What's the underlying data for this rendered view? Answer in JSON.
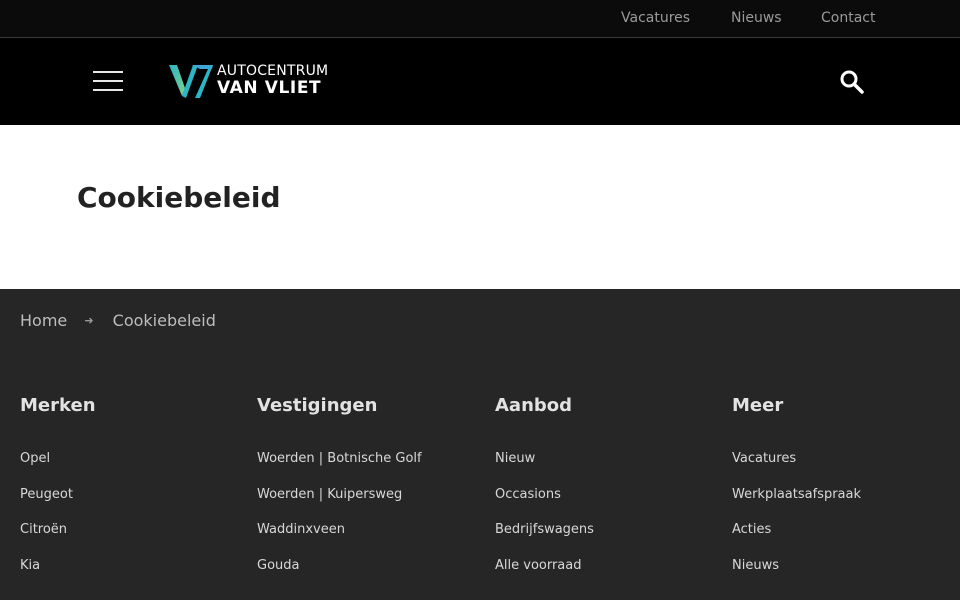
{
  "topnav": {
    "links": [
      "Vacatures",
      "Nieuws",
      "Contact"
    ]
  },
  "header": {
    "menu_icon": "hamburger-menu-icon",
    "logo": {
      "line1": "AUTOCENTRUM",
      "line2": "VAN VLIET"
    },
    "search_icon": "search-icon"
  },
  "page": {
    "title": "Cookiebeleid"
  },
  "breadcrumb": {
    "home": "Home",
    "separator_icon": "arrow-right-icon",
    "current": "Cookiebeleid"
  },
  "footer": {
    "columns": [
      {
        "title": "Merken",
        "items": [
          "Opel",
          "Peugeot",
          "Citroën",
          "Kia"
        ]
      },
      {
        "title": "Vestigingen",
        "items": [
          "Woerden | Botnische Golf",
          "Woerden | Kuipersweg",
          "Waddinxveen",
          "Gouda"
        ]
      },
      {
        "title": "Aanbod",
        "items": [
          "Nieuw",
          "Occasions",
          "Bedrijfswagens",
          "Alle voorraad"
        ]
      },
      {
        "title": "Meer",
        "items": [
          "Vacatures",
          "Werkplaatsafspraak",
          "Acties",
          "Nieuws"
        ]
      }
    ]
  },
  "colors": {
    "topbar_bg": "#0b0b0b",
    "header_bg": "#000000",
    "footer_bg": "#262626",
    "logo_teal": "#2bb6c8",
    "logo_green": "#7fd08a"
  }
}
